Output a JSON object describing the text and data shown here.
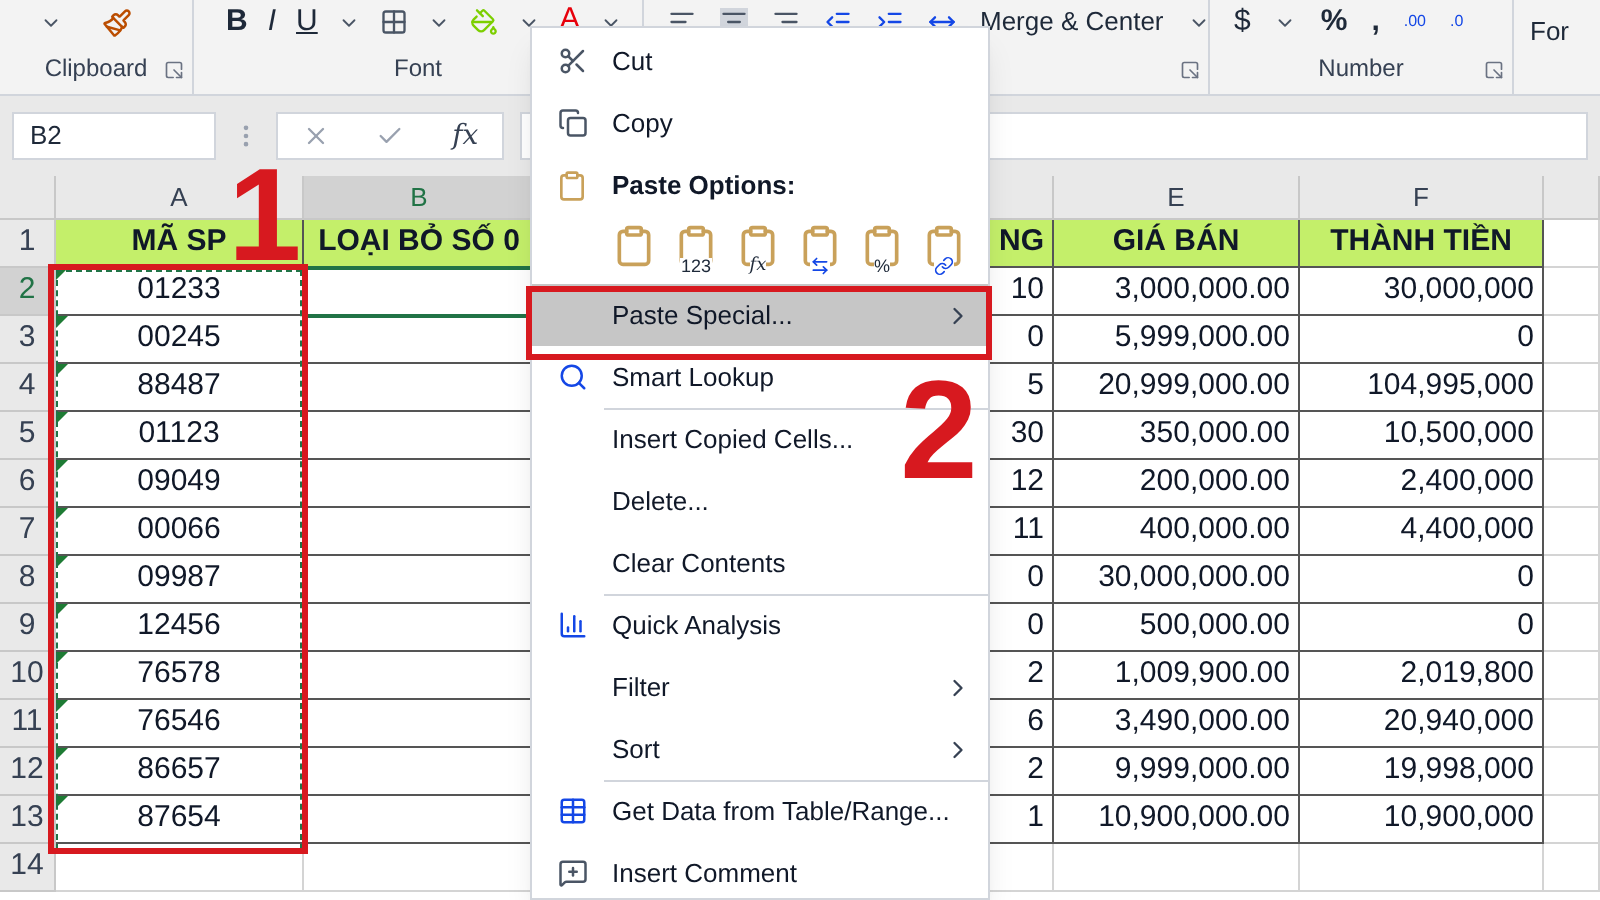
{
  "ribbon": {
    "groups": [
      {
        "label": "Clipboard",
        "launcher": true
      },
      {
        "label": "Font",
        "launcher": false
      },
      {
        "launcher": true
      },
      {
        "label": "Number",
        "launcher": true
      }
    ],
    "font_buttons": [
      "B",
      "I",
      "U"
    ],
    "font_color_label": "A",
    "merge_label": "Merge & Center",
    "number_buttons": [
      "$",
      "%",
      ","
    ],
    "decimal_buttons": [
      ".00",
      ".0"
    ],
    "next_group_label": "For"
  },
  "formula_bar": {
    "name_box": "B2",
    "function_label": "fx"
  },
  "table": {
    "columns": [
      {
        "letter": "A",
        "heading": "MÃ SP"
      },
      {
        "letter": "B",
        "heading": "LOẠI BỎ SỐ 0"
      },
      {
        "heading": "NG"
      },
      {
        "letter": "E",
        "heading": "GIÁ BÁN"
      },
      {
        "letter": "F",
        "heading": "THÀNH TIỀN"
      }
    ],
    "header_row": "1",
    "rows": [
      {
        "number": "2",
        "selected": true,
        "cells": [
          "01233",
          "",
          "10",
          "3,000,000.00",
          "30,000,000"
        ]
      },
      {
        "number": "3",
        "selected": false,
        "cells": [
          "00245",
          "",
          "0",
          "5,999,000.00",
          "0"
        ]
      },
      {
        "number": "4",
        "selected": false,
        "cells": [
          "88487",
          "",
          "5",
          "20,999,000.00",
          "104,995,000"
        ]
      },
      {
        "number": "5",
        "selected": false,
        "cells": [
          "01123",
          "",
          "30",
          "350,000.00",
          "10,500,000"
        ]
      },
      {
        "number": "6",
        "selected": false,
        "cells": [
          "09049",
          "",
          "12",
          "200,000.00",
          "2,400,000"
        ]
      },
      {
        "number": "7",
        "selected": false,
        "cells": [
          "00066",
          "",
          "11",
          "400,000.00",
          "4,400,000"
        ]
      },
      {
        "number": "8",
        "selected": false,
        "cells": [
          "09987",
          "",
          "0",
          "30,000,000.00",
          "0"
        ]
      },
      {
        "number": "9",
        "selected": false,
        "cells": [
          "12456",
          "",
          "0",
          "500,000.00",
          "0"
        ]
      },
      {
        "number": "10",
        "selected": false,
        "cells": [
          "76578",
          "",
          "2",
          "1,009,900.00",
          "2,019,800"
        ]
      },
      {
        "number": "11",
        "selected": false,
        "cells": [
          "76546",
          "",
          "6",
          "3,490,000.00",
          "20,940,000"
        ]
      },
      {
        "number": "12",
        "selected": false,
        "cells": [
          "86657",
          "",
          "2",
          "9,999,000.00",
          "19,998,000"
        ]
      },
      {
        "number": "13",
        "selected": false,
        "cells": [
          "87654",
          "",
          "1",
          "10,900,000.00",
          "10,900,000"
        ]
      }
    ],
    "empty_rows": [
      "14"
    ]
  },
  "context_menu": {
    "items": [
      {
        "kind": "item",
        "label": "Cut",
        "selected": false,
        "submenu": false
      },
      {
        "kind": "item",
        "label": "Copy",
        "selected": false,
        "submenu": false
      },
      {
        "kind": "header",
        "label": "Paste Options:"
      },
      {
        "kind": "paste_options",
        "options": [
          {
            "kind": "paste"
          },
          {
            "kind": "values",
            "label": "123"
          },
          {
            "kind": "formulas",
            "label": "fx"
          },
          {
            "kind": "transpose"
          },
          {
            "kind": "formatting",
            "label": "%"
          },
          {
            "kind": "link"
          }
        ]
      },
      {
        "kind": "item",
        "label": "Paste Special...",
        "selected": true,
        "submenu": true
      },
      {
        "kind": "item",
        "label": "Smart Lookup",
        "selected": false,
        "submenu": false
      },
      {
        "kind": "separator"
      },
      {
        "kind": "item",
        "label": "Insert Copied Cells...",
        "selected": false,
        "submenu": false
      },
      {
        "kind": "item",
        "label": "Delete...",
        "selected": false,
        "submenu": false
      },
      {
        "kind": "item",
        "label": "Clear Contents",
        "selected": false,
        "submenu": false
      },
      {
        "kind": "separator"
      },
      {
        "kind": "item",
        "label": "Quick Analysis",
        "selected": false,
        "submenu": false
      },
      {
        "kind": "item",
        "label": "Filter",
        "selected": false,
        "submenu": true
      },
      {
        "kind": "item",
        "label": "Sort",
        "selected": false,
        "submenu": true
      },
      {
        "kind": "separator"
      },
      {
        "kind": "item",
        "label": "Get Data from Table/Range...",
        "selected": false,
        "submenu": false
      },
      {
        "kind": "item",
        "label": "Insert Comment",
        "selected": false,
        "submenu": false
      }
    ]
  },
  "annotations": [
    {
      "label": "1"
    },
    {
      "label": "2"
    }
  ]
}
